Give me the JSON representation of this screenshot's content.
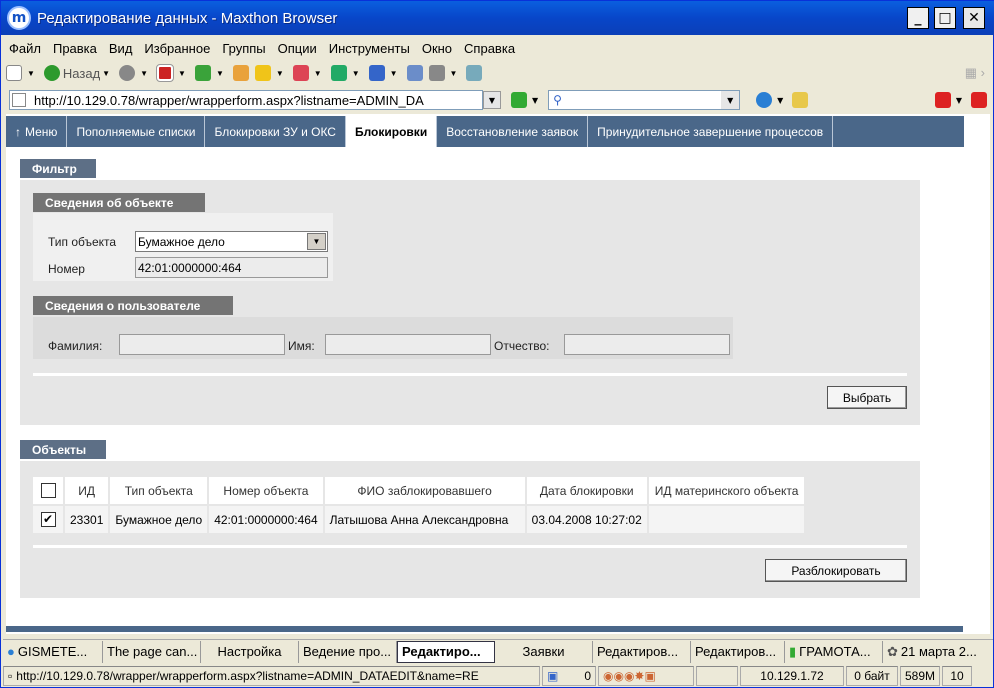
{
  "window": {
    "title": "Редактирование данных - Maxthon Browser"
  },
  "menu": [
    "Файл",
    "Правка",
    "Вид",
    "Избранное",
    "Группы",
    "Опции",
    "Инструменты",
    "Окно",
    "Справка"
  ],
  "toolbar": {
    "back_label": "Назад"
  },
  "address": {
    "url": "http://10.129.0.78/wrapper/wrapperform.aspx?listname=ADMIN_DA"
  },
  "nav": {
    "menu_label": "Меню",
    "tabs": [
      "Пополняемые списки",
      "Блокировки ЗУ и ОКС",
      "Блокировки",
      "Восстановление заявок",
      "Принудительное завершение процессов"
    ],
    "active_index": 2
  },
  "filter": {
    "title": "Фильтр",
    "object_section": "Сведения об объекте",
    "object_type_label": "Тип объекта",
    "object_type_value": "Бумажное дело",
    "number_label": "Номер",
    "number_value": "42:01:0000000:464",
    "user_section": "Сведения о пользователе",
    "surname_label": "Фамилия:",
    "name_label": "Имя:",
    "patronymic_label": "Отчество:",
    "select_button": "Выбрать"
  },
  "objects": {
    "title": "Объекты",
    "columns": [
      "ИД",
      "Тип объекта",
      "Номер объекта",
      "ФИО заблокировавшего",
      "Дата блокировки",
      "ИД материнского объекта"
    ],
    "rows": [
      {
        "checked": true,
        "id": "23301",
        "type": "Бумажное дело",
        "number": "42:01:0000000:464",
        "fio": "Латышова Анна Александровна",
        "date": "03.04.2008 10:27:02",
        "parent_id": ""
      }
    ],
    "unlock_button": "Разблокировать"
  },
  "taskbar": [
    "GISMETE...",
    "The page can...",
    "Настройка",
    "Ведение про...",
    "Редактиро...",
    "Заявки",
    "Редактиров...",
    "Редактиров...",
    "ГРАМОТА...",
    "21 марта 2..."
  ],
  "taskbar_active": 4,
  "status": {
    "url": "http://10.129.0.78/wrapper/wrapperform.aspx?listname=ADMIN_DATAEDIT&name=RE",
    "counter": "0",
    "ip": "10.129.1.72",
    "bytes": "0 байт",
    "memory": "589M",
    "num": "10"
  }
}
